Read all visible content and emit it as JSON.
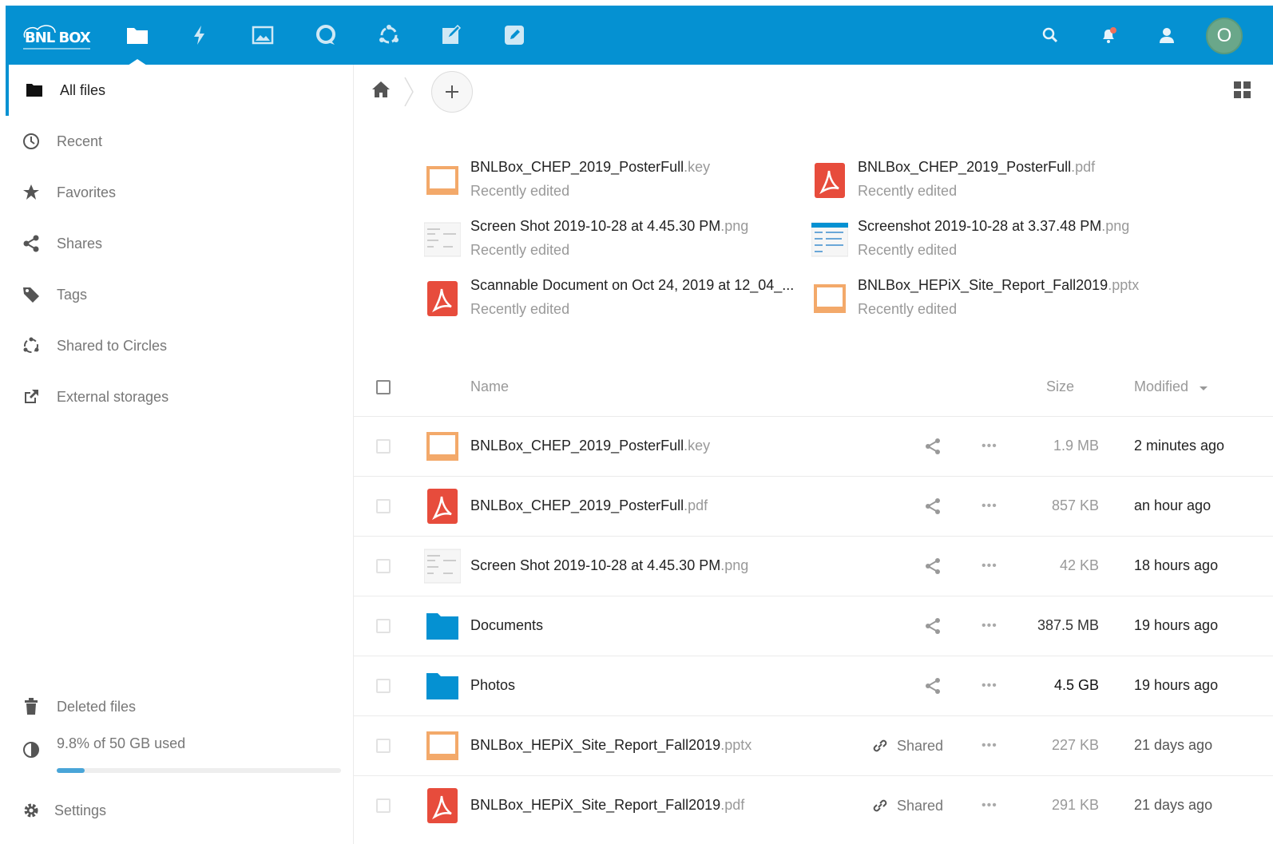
{
  "header": {
    "logo_text": "BNL BOX",
    "apps": [
      {
        "icon": "folder-icon",
        "name": "files"
      },
      {
        "icon": "lightning-icon",
        "name": "activity"
      },
      {
        "icon": "image-icon",
        "name": "gallery"
      },
      {
        "icon": "talk-icon",
        "name": "talk"
      },
      {
        "icon": "circles-icon",
        "name": "circles"
      },
      {
        "icon": "notes-icon",
        "name": "notes"
      },
      {
        "icon": "edit-icon",
        "name": "editor"
      }
    ],
    "avatar_letter": "O",
    "colors": {
      "accent": "#0591d2",
      "avatar": "#6aa78a"
    }
  },
  "sidebar": {
    "items": [
      {
        "label": "All files",
        "icon": "folder-icon",
        "active": true
      },
      {
        "label": "Recent",
        "icon": "clock-icon"
      },
      {
        "label": "Favorites",
        "icon": "star-icon"
      },
      {
        "label": "Shares",
        "icon": "share-icon"
      },
      {
        "label": "Tags",
        "icon": "tag-icon"
      },
      {
        "label": "Shared to Circles",
        "icon": "circles-icon"
      },
      {
        "label": "External storages",
        "icon": "external-icon"
      }
    ],
    "deleted": "Deleted files",
    "quota": "9.8% of 50 GB used",
    "quota_fraction": 0.098,
    "settings": "Settings"
  },
  "recent": [
    {
      "name": "BNLBox_CHEP_2019_PosterFull",
      "ext": ".key",
      "status": "Recently edited",
      "type": "slides"
    },
    {
      "name": "BNLBox_CHEP_2019_PosterFull",
      "ext": ".pdf",
      "status": "Recently edited",
      "type": "pdf"
    },
    {
      "name": "Screen Shot 2019-10-28 at 4.45.30 PM",
      "ext": ".png",
      "status": "Recently edited",
      "type": "image"
    },
    {
      "name": "Screenshot 2019-10-28 at 3.37.48 PM",
      "ext": ".png",
      "status": "Recently edited",
      "type": "image"
    },
    {
      "name": "Scannable Document on Oct 24, 2019 at 12_04_...",
      "ext": "",
      "status": "Recently edited",
      "type": "pdf"
    },
    {
      "name": "BNLBox_HEPiX_Site_Report_Fall2019",
      "ext": ".pptx",
      "status": "Recently edited",
      "type": "slides"
    }
  ],
  "table": {
    "headers": {
      "name": "Name",
      "size": "Size",
      "modified": "Modified"
    },
    "rows": [
      {
        "name": "BNLBox_CHEP_2019_PosterFull",
        "ext": ".key",
        "size": "1.9 MB",
        "modified": "2 minutes ago",
        "shared": "",
        "type": "slides"
      },
      {
        "name": "BNLBox_CHEP_2019_PosterFull",
        "ext": ".pdf",
        "size": "857 KB",
        "modified": "an hour ago",
        "shared": "",
        "type": "pdf"
      },
      {
        "name": "Screen Shot 2019-10-28 at 4.45.30 PM",
        "ext": ".png",
        "size": "42 KB",
        "modified": "18 hours ago",
        "shared": "",
        "type": "image"
      },
      {
        "name": "Documents",
        "ext": "",
        "size": "387.5 MB",
        "modified": "19 hours ago",
        "shared": "",
        "type": "folder"
      },
      {
        "name": "Photos",
        "ext": "",
        "size": "4.5 GB",
        "modified": "19 hours ago",
        "shared": "",
        "type": "folder"
      },
      {
        "name": "BNLBox_HEPiX_Site_Report_Fall2019",
        "ext": ".pptx",
        "size": "227 KB",
        "modified": "21 days ago",
        "shared": "Shared",
        "type": "slides"
      },
      {
        "name": "BNLBox_HEPiX_Site_Report_Fall2019",
        "ext": ".pdf",
        "size": "291 KB",
        "modified": "21 days ago",
        "shared": "Shared",
        "type": "pdf"
      }
    ]
  }
}
